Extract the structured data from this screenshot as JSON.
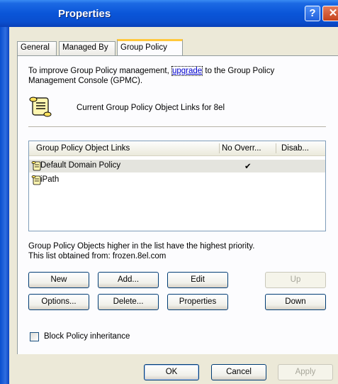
{
  "window": {
    "title": "Properties",
    "help_label": "?",
    "close_label": "✕"
  },
  "tabs": [
    {
      "label": "General"
    },
    {
      "label": "Managed By"
    },
    {
      "label": "Group Policy"
    }
  ],
  "info": {
    "line1_pre": "To improve Group Policy management, ",
    "link": "upgrade",
    "line1_post": " to the Group Policy",
    "line2": "Management Console (GPMC).",
    "current_links": "Current Group Policy Object Links for 8el"
  },
  "list": {
    "columns": [
      {
        "label": "Group Policy Object Links"
      },
      {
        "label": "No Overr..."
      },
      {
        "label": "Disab..."
      }
    ],
    "rows": [
      {
        "name": "Default Domain Policy",
        "no_override": "✔",
        "disabled": ""
      },
      {
        "name": "iPath",
        "no_override": "",
        "disabled": ""
      }
    ]
  },
  "notes": {
    "priority": "Group Policy Objects higher in the list have the highest priority.",
    "obtained": "This list obtained from: frozen.8el.com"
  },
  "buttons": {
    "new": "New",
    "add": "Add...",
    "edit": "Edit",
    "up": "Up",
    "options": "Options...",
    "delete": "Delete...",
    "properties": "Properties",
    "down": "Down"
  },
  "block_inheritance": {
    "label": "Block Policy inheritance",
    "checked": false
  },
  "footer": {
    "ok": "OK",
    "cancel": "Cancel",
    "apply": "Apply"
  },
  "colors": {
    "title_bar": "#0a55d8",
    "tab_highlight": "#ffc83c",
    "link": "#0000cc",
    "panel": "#fcfcfe",
    "dialog": "#ece9d8"
  }
}
